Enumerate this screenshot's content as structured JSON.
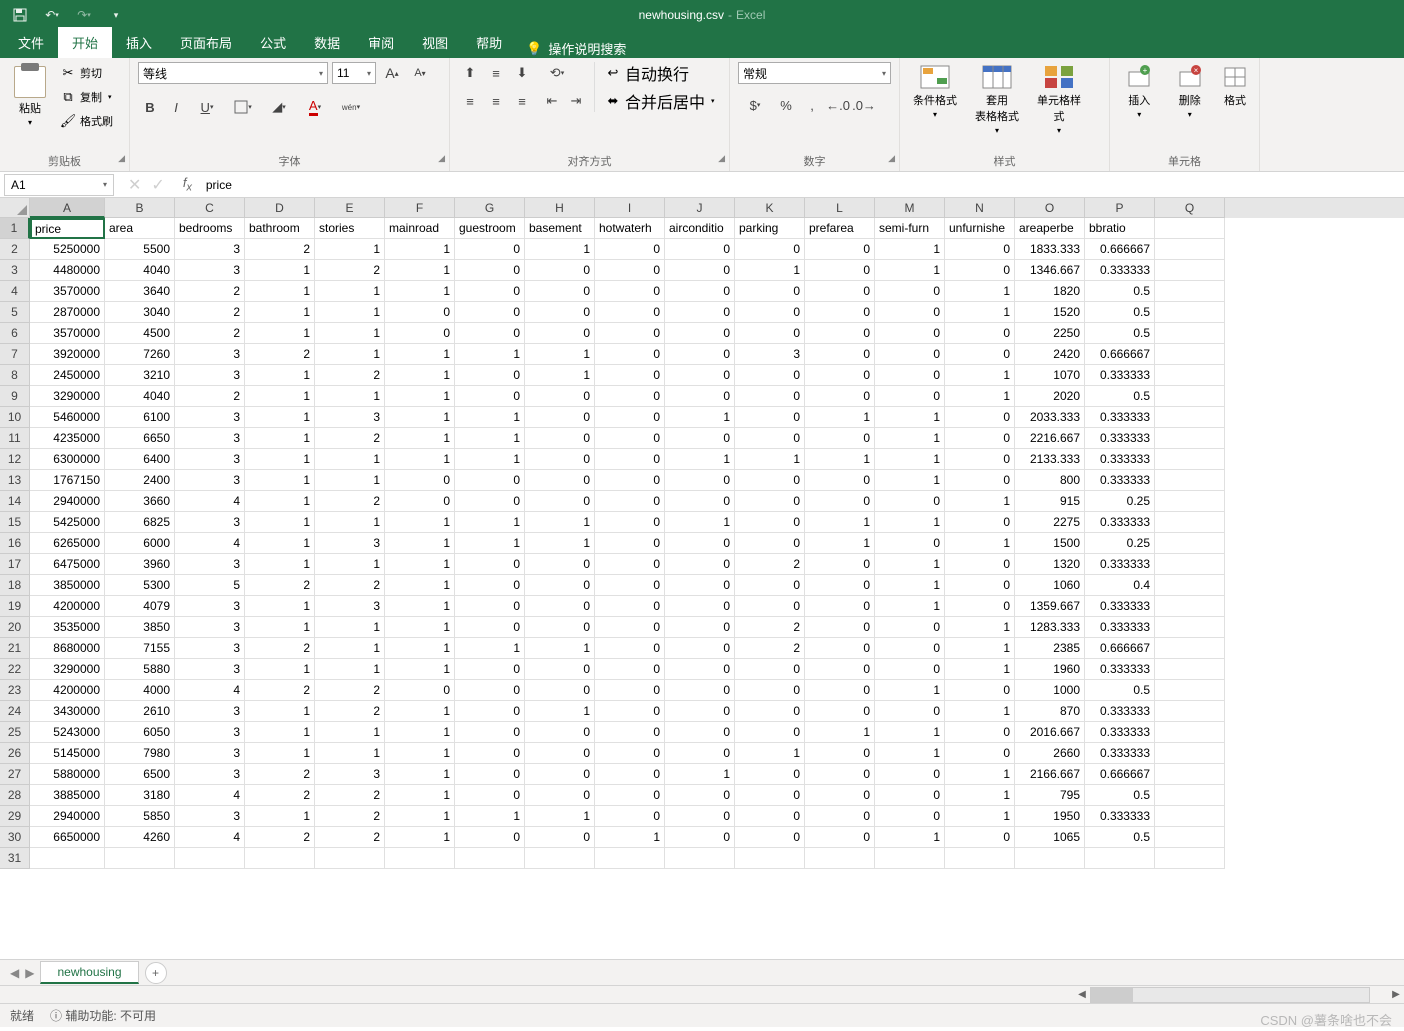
{
  "title": {
    "filename": "newhousing.csv",
    "app": "Excel"
  },
  "tabs": {
    "file": "文件",
    "home": "开始",
    "insert": "插入",
    "layout": "页面布局",
    "formulas": "公式",
    "data": "数据",
    "review": "审阅",
    "view": "视图",
    "help": "帮助",
    "tellme": "操作说明搜索"
  },
  "ribbon": {
    "clipboard": {
      "paste": "粘贴",
      "cut": "剪切",
      "copy": "复制",
      "painter": "格式刷",
      "label": "剪贴板"
    },
    "font": {
      "name": "等线",
      "size": "11",
      "label": "字体"
    },
    "align": {
      "wrap": "自动换行",
      "merge": "合并后居中",
      "label": "对齐方式"
    },
    "number": {
      "format": "常规",
      "label": "数字"
    },
    "styles": {
      "cond": "条件格式",
      "table": "套用\n表格格式",
      "cell": "单元格样式",
      "label": "样式"
    },
    "cells": {
      "insert": "插入",
      "delete": "删除",
      "format": "格式",
      "label": "单元格"
    }
  },
  "namebox": "A1",
  "formula": "price",
  "columns": [
    "A",
    "B",
    "C",
    "D",
    "E",
    "F",
    "G",
    "H",
    "I",
    "J",
    "K",
    "L",
    "M",
    "N",
    "O",
    "P",
    "Q"
  ],
  "headers": [
    "price",
    "area",
    "bedrooms",
    "bathroom",
    "stories",
    "mainroad",
    "guestroom",
    "basement",
    "hotwaterh",
    "airconditio",
    "parking",
    "prefarea",
    "semi-furn",
    "unfurnishe",
    "areaperbe",
    "bbratio",
    ""
  ],
  "data": [
    [
      5250000,
      5500,
      3,
      2,
      1,
      1,
      0,
      1,
      0,
      0,
      0,
      0,
      1,
      0,
      "1833.333",
      "0.666667"
    ],
    [
      4480000,
      4040,
      3,
      1,
      2,
      1,
      0,
      0,
      0,
      0,
      1,
      0,
      1,
      0,
      "1346.667",
      "0.333333"
    ],
    [
      3570000,
      3640,
      2,
      1,
      1,
      1,
      0,
      0,
      0,
      0,
      0,
      0,
      0,
      1,
      1820,
      0.5
    ],
    [
      2870000,
      3040,
      2,
      1,
      1,
      0,
      0,
      0,
      0,
      0,
      0,
      0,
      0,
      1,
      1520,
      0.5
    ],
    [
      3570000,
      4500,
      2,
      1,
      1,
      0,
      0,
      0,
      0,
      0,
      0,
      0,
      0,
      0,
      2250,
      0.5
    ],
    [
      3920000,
      7260,
      3,
      2,
      1,
      1,
      1,
      1,
      0,
      0,
      3,
      0,
      0,
      0,
      2420,
      "0.666667"
    ],
    [
      2450000,
      3210,
      3,
      1,
      2,
      1,
      0,
      1,
      0,
      0,
      0,
      0,
      0,
      1,
      1070,
      "0.333333"
    ],
    [
      3290000,
      4040,
      2,
      1,
      1,
      1,
      0,
      0,
      0,
      0,
      0,
      0,
      0,
      1,
      2020,
      0.5
    ],
    [
      5460000,
      6100,
      3,
      1,
      3,
      1,
      1,
      0,
      0,
      1,
      0,
      1,
      1,
      0,
      "2033.333",
      "0.333333"
    ],
    [
      4235000,
      6650,
      3,
      1,
      2,
      1,
      1,
      0,
      0,
      0,
      0,
      0,
      1,
      0,
      "2216.667",
      "0.333333"
    ],
    [
      6300000,
      6400,
      3,
      1,
      1,
      1,
      1,
      0,
      0,
      1,
      1,
      1,
      1,
      0,
      "2133.333",
      "0.333333"
    ],
    [
      1767150,
      2400,
      3,
      1,
      1,
      0,
      0,
      0,
      0,
      0,
      0,
      0,
      1,
      0,
      800,
      "0.333333"
    ],
    [
      2940000,
      3660,
      4,
      1,
      2,
      0,
      0,
      0,
      0,
      0,
      0,
      0,
      0,
      1,
      915,
      0.25
    ],
    [
      5425000,
      6825,
      3,
      1,
      1,
      1,
      1,
      1,
      0,
      1,
      0,
      1,
      1,
      0,
      2275,
      "0.333333"
    ],
    [
      6265000,
      6000,
      4,
      1,
      3,
      1,
      1,
      1,
      0,
      0,
      0,
      1,
      0,
      1,
      1500,
      0.25
    ],
    [
      6475000,
      3960,
      3,
      1,
      1,
      1,
      0,
      0,
      0,
      0,
      2,
      0,
      1,
      0,
      1320,
      "0.333333"
    ],
    [
      3850000,
      5300,
      5,
      2,
      2,
      1,
      0,
      0,
      0,
      0,
      0,
      0,
      1,
      0,
      1060,
      0.4
    ],
    [
      4200000,
      4079,
      3,
      1,
      3,
      1,
      0,
      0,
      0,
      0,
      0,
      0,
      1,
      0,
      "1359.667",
      "0.333333"
    ],
    [
      3535000,
      3850,
      3,
      1,
      1,
      1,
      0,
      0,
      0,
      0,
      2,
      0,
      0,
      1,
      "1283.333",
      "0.333333"
    ],
    [
      8680000,
      7155,
      3,
      2,
      1,
      1,
      1,
      1,
      0,
      0,
      2,
      0,
      0,
      1,
      2385,
      "0.666667"
    ],
    [
      3290000,
      5880,
      3,
      1,
      1,
      1,
      0,
      0,
      0,
      0,
      0,
      0,
      0,
      1,
      1960,
      "0.333333"
    ],
    [
      4200000,
      4000,
      4,
      2,
      2,
      0,
      0,
      0,
      0,
      0,
      0,
      0,
      1,
      0,
      1000,
      0.5
    ],
    [
      3430000,
      2610,
      3,
      1,
      2,
      1,
      0,
      1,
      0,
      0,
      0,
      0,
      0,
      1,
      870,
      "0.333333"
    ],
    [
      5243000,
      6050,
      3,
      1,
      1,
      1,
      0,
      0,
      0,
      0,
      0,
      1,
      1,
      0,
      "2016.667",
      "0.333333"
    ],
    [
      5145000,
      7980,
      3,
      1,
      1,
      1,
      0,
      0,
      0,
      0,
      1,
      0,
      1,
      0,
      2660,
      "0.333333"
    ],
    [
      5880000,
      6500,
      3,
      2,
      3,
      1,
      0,
      0,
      0,
      1,
      0,
      0,
      0,
      1,
      "2166.667",
      "0.666667"
    ],
    [
      3885000,
      3180,
      4,
      2,
      2,
      1,
      0,
      0,
      0,
      0,
      0,
      0,
      0,
      1,
      795,
      0.5
    ],
    [
      2940000,
      5850,
      3,
      1,
      2,
      1,
      1,
      1,
      0,
      0,
      0,
      0,
      0,
      1,
      1950,
      "0.333333"
    ],
    [
      6650000,
      4260,
      4,
      2,
      2,
      1,
      0,
      0,
      1,
      0,
      0,
      0,
      1,
      0,
      1065,
      0.5
    ]
  ],
  "sheet": {
    "name": "newhousing"
  },
  "status": {
    "ready": "就绪",
    "accessibility": "辅助功能: 不可用"
  },
  "watermark": "CSDN @薯条啥也不会"
}
